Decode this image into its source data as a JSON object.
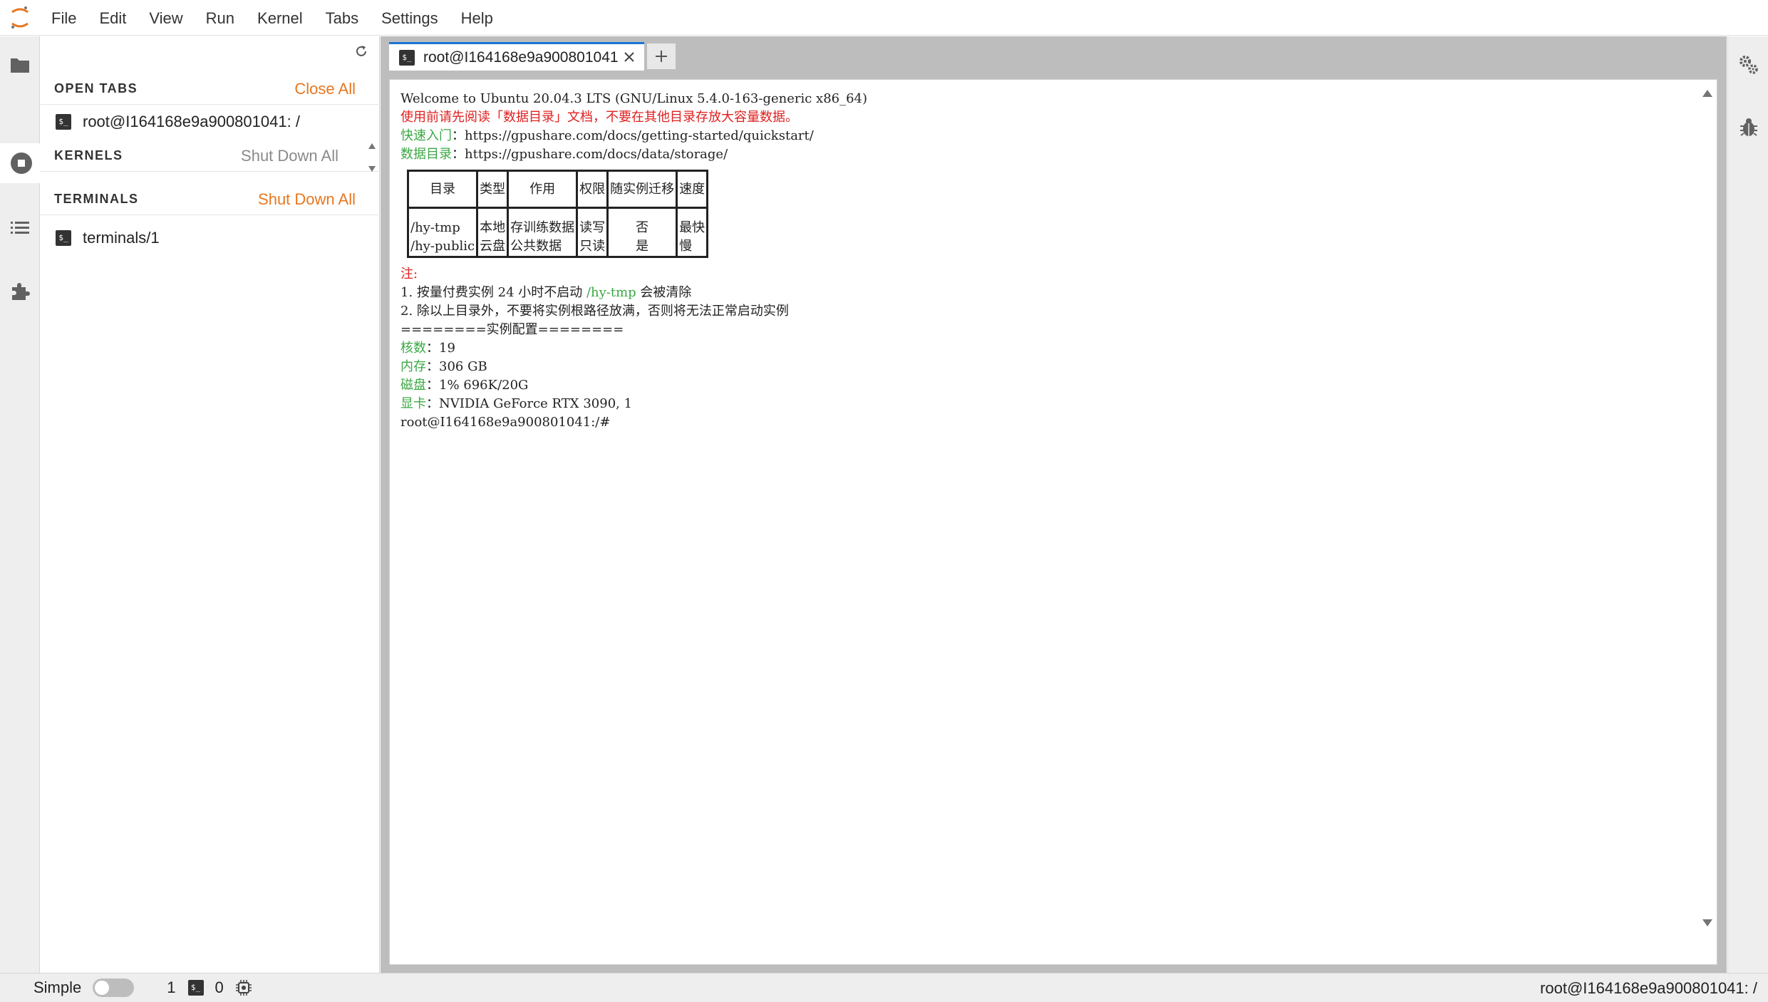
{
  "menu": [
    "File",
    "Edit",
    "View",
    "Run",
    "Kernel",
    "Tabs",
    "Settings",
    "Help"
  ],
  "sidebar": {
    "open_tabs": {
      "title": "OPEN TABS",
      "action": "Close All",
      "items": [
        "root@I164168e9a900801041: /"
      ]
    },
    "kernels": {
      "title": "KERNELS",
      "action": "Shut Down All"
    },
    "terminals": {
      "title": "TERMINALS",
      "action": "Shut Down All",
      "items": [
        "terminals/1"
      ]
    }
  },
  "tabs": [
    {
      "label": "root@I164168e9a900801041",
      "icon": "terminal-icon"
    }
  ],
  "terminal": {
    "welcome": "Welcome to Ubuntu 20.04.3 LTS (GNU/Linux 5.4.0-163-generic x86_64)",
    "warning": "使用前请先阅读「数据目录」文档，不要在其他目录存放大容量数据。",
    "quickstart_label": "快速入门",
    "quickstart_url": "：https://gpushare.com/docs/getting-started/quickstart/",
    "datadir_label": "数据目录",
    "datadir_url": "：https://gpushare.com/docs/data/storage/",
    "table": {
      "headers": [
        "目录",
        "类型",
        "作用",
        "权限",
        "随实例迁移",
        "速度"
      ],
      "rows": [
        [
          "/hy-tmp",
          "本地",
          "存训练数据",
          "读写",
          "否",
          "最快"
        ],
        [
          "/hy-public",
          "云盘",
          "公共数据",
          "只读",
          "是",
          "慢"
        ]
      ]
    },
    "note_label": "注:",
    "note1_pre": "1. 按量付费实例 24 小时不启动 ",
    "note1_path": "/hy-tmp",
    "note1_post": " 会被清除",
    "note2": "2. 除以上目录外，不要将实例根路径放满，否则将无法正常启动实例",
    "config_header": "========实例配置========",
    "cores_label": "核数",
    "cores_value": "：19",
    "mem_label": "内存",
    "mem_value": "：306 GB",
    "disk_label": "磁盘",
    "disk_value": "：1% 696K/20G",
    "gpu_label": "显卡",
    "gpu_value": "：NVIDIA GeForce RTX 3090, 1",
    "prompt": "root@I164168e9a900801041:/#"
  },
  "statusbar": {
    "mode": "Simple",
    "kernels_count": "1",
    "terminals_count": "0",
    "right_text": "root@I164168e9a900801041: /"
  },
  "colors": {
    "accent": "#e87720",
    "tab_border": "#1976d2",
    "term_red": "#e02020",
    "term_green": "#3aa843"
  }
}
